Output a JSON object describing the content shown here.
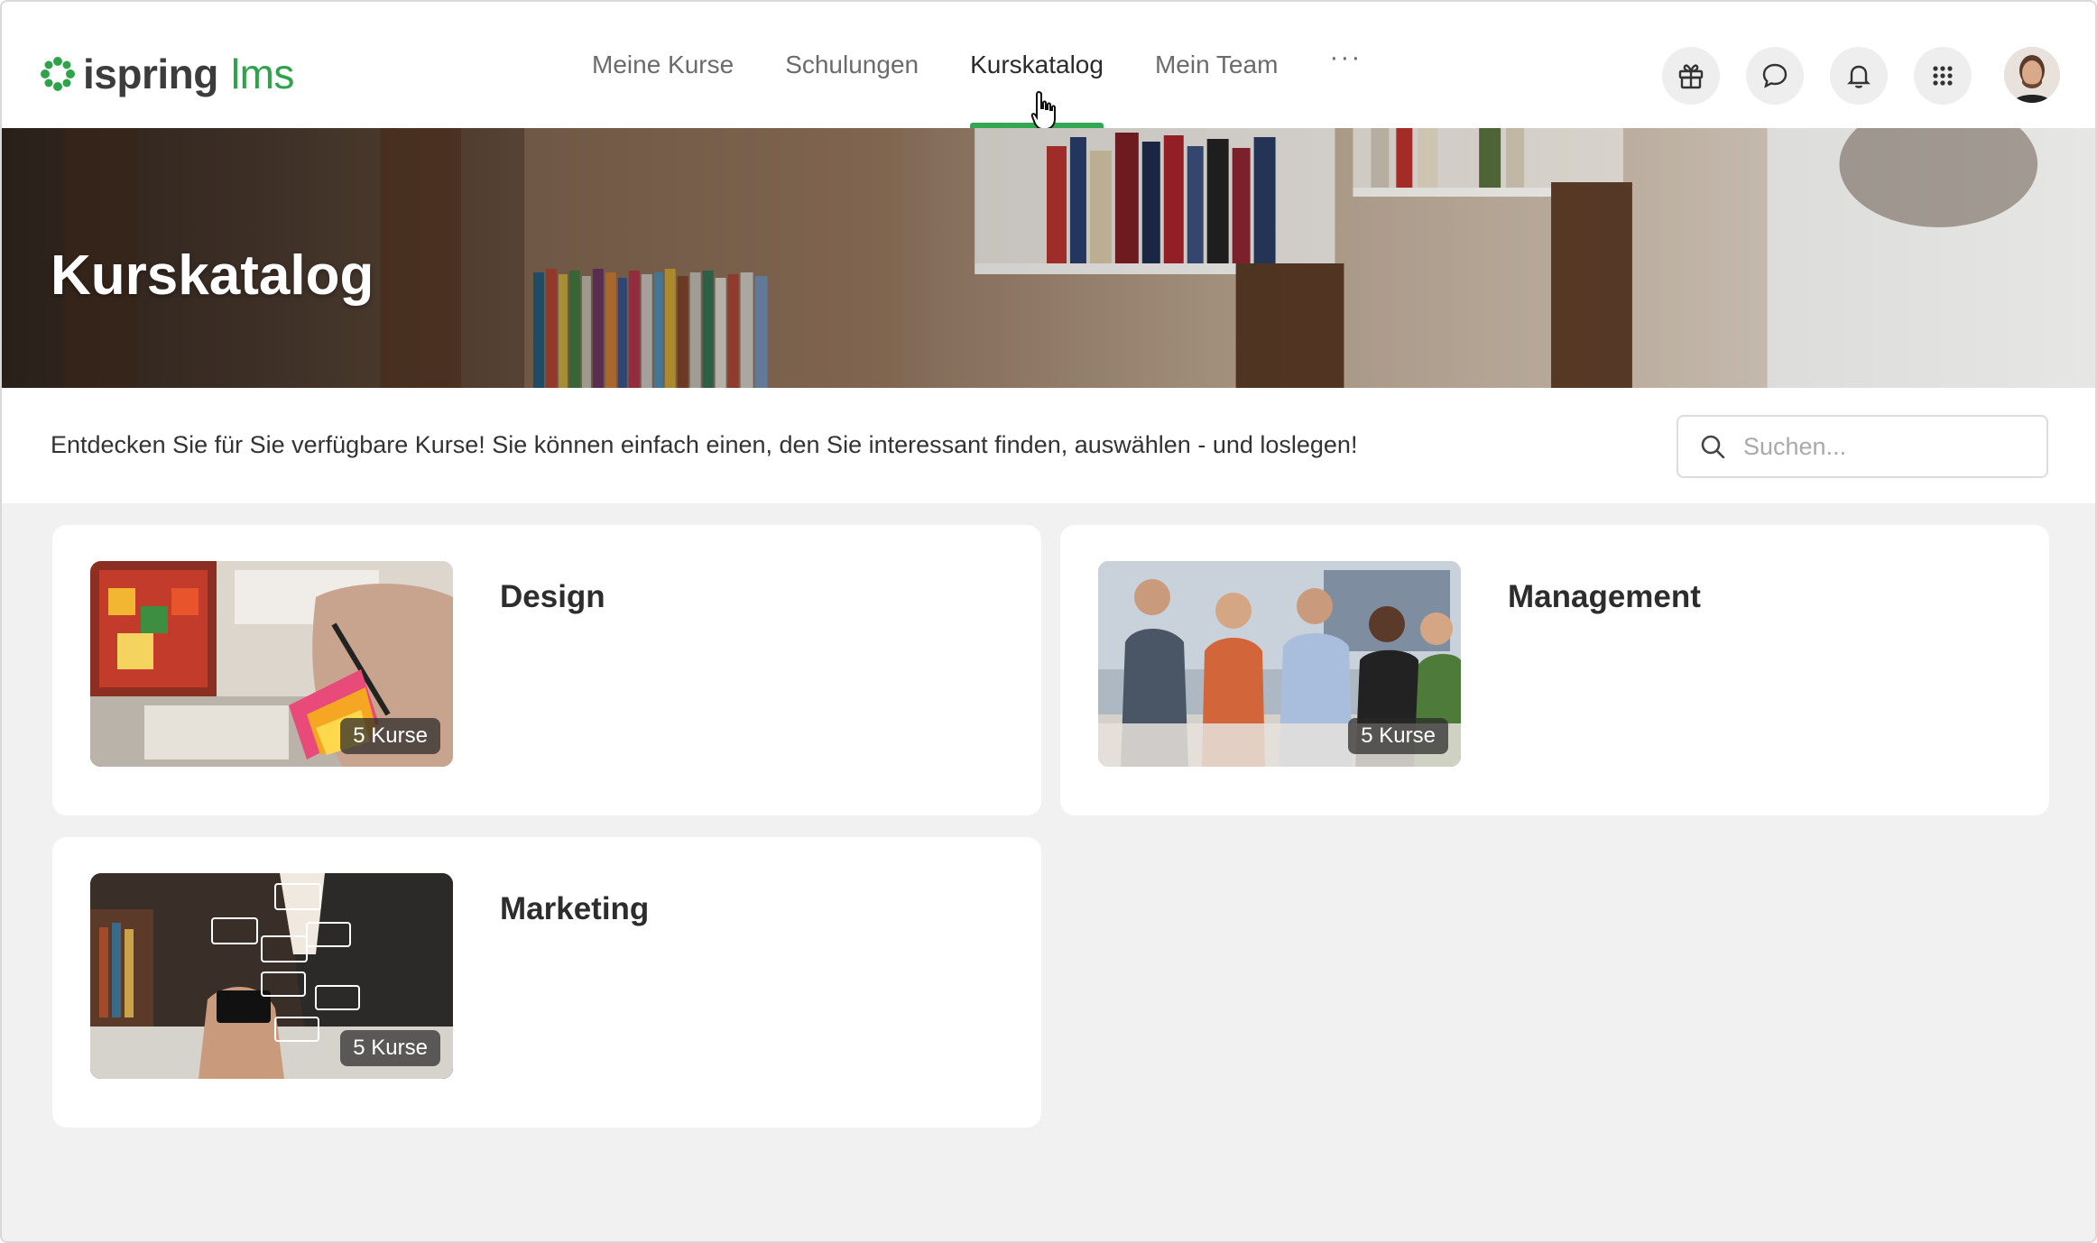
{
  "brand": {
    "name": "ispring",
    "product": "lms",
    "accent_color": "#33a853"
  },
  "nav": {
    "items": [
      {
        "label": "Meine Kurse",
        "active": false
      },
      {
        "label": "Schulungen",
        "active": false
      },
      {
        "label": "Kurskatalog",
        "active": true
      },
      {
        "label": "Mein Team",
        "active": false
      }
    ],
    "more_label": "···"
  },
  "header_actions": [
    "gift-icon",
    "chat-icon",
    "bell-icon",
    "apps-grid-icon",
    "avatar"
  ],
  "banner": {
    "title": "Kurskatalog"
  },
  "intro": {
    "text": "Entdecken Sie für Sie verfügbare Kurse! Sie können einfach einen, den Sie interessant finden, auswählen - und loslegen!"
  },
  "search": {
    "placeholder": "Suchen...",
    "value": ""
  },
  "categories": [
    {
      "title": "Design",
      "count_label": "5 Kurse"
    },
    {
      "title": "Management",
      "count_label": "5 Kurse"
    },
    {
      "title": "Marketing",
      "count_label": "5 Kurse"
    }
  ]
}
